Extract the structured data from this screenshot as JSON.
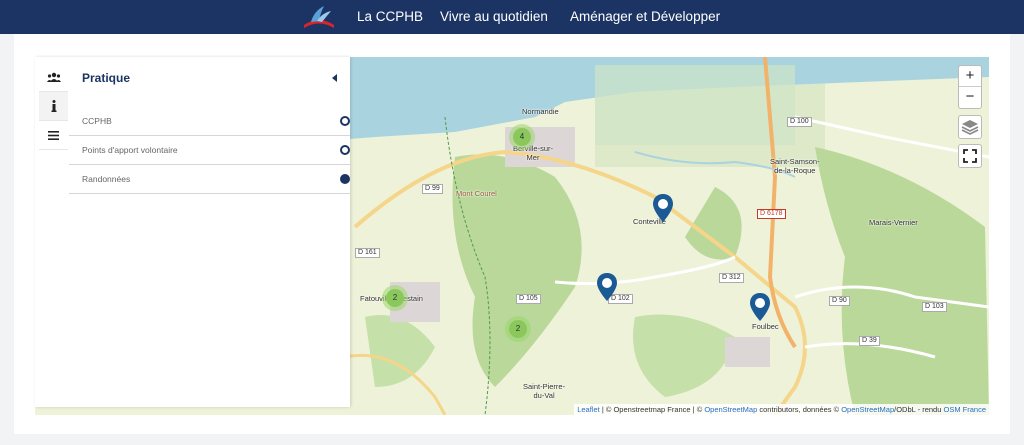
{
  "nav": {
    "items": [
      "La CCPHB",
      "Vivre au quotidien",
      "Aménager et Développer"
    ]
  },
  "sidebar": {
    "title": "Pratique",
    "layers": [
      "CCPHB",
      "Points d'apport volontaire",
      "Randonnées"
    ],
    "tabs": [
      "users-icon",
      "info-icon",
      "menu-icon"
    ]
  },
  "map": {
    "places": {
      "gonneville": "Berville-sur-\nMer",
      "conteville": "Conteville",
      "saint_samson": "Saint-Samson-\nde-la-Roque",
      "marais_vernier": "Marais-Vernier",
      "fatouville": "Fatouville-Grestain",
      "foulbec": "Foulbec",
      "saint_pierre": "Saint-Pierre-\ndu-Val",
      "mont_courel": "Mont Courel",
      "normandie": "Normandie"
    },
    "roads": [
      "D 100",
      "D 99",
      "D 161",
      "D 105",
      "D 102",
      "D 312",
      "D 6178",
      "D 90",
      "D 39",
      "D 103"
    ],
    "clusters": [
      "4",
      "2",
      "2"
    ],
    "controls": {
      "zoom_in": "+",
      "zoom_out": "−"
    },
    "attribution": {
      "leaflet": "Leaflet",
      "sep1": " | © Openstreetmap France | © ",
      "osm": "OpenStreetMap",
      "text2": " contributors, données © ",
      "osm2": "OpenStreetMap",
      "text3": "/ODbL - rendu ",
      "osmfr": "OSM France"
    }
  },
  "colors": {
    "nav": "#1c3464",
    "marker": "#1c5a96",
    "cluster": "#8bc75a",
    "water": "#a9d3df"
  }
}
